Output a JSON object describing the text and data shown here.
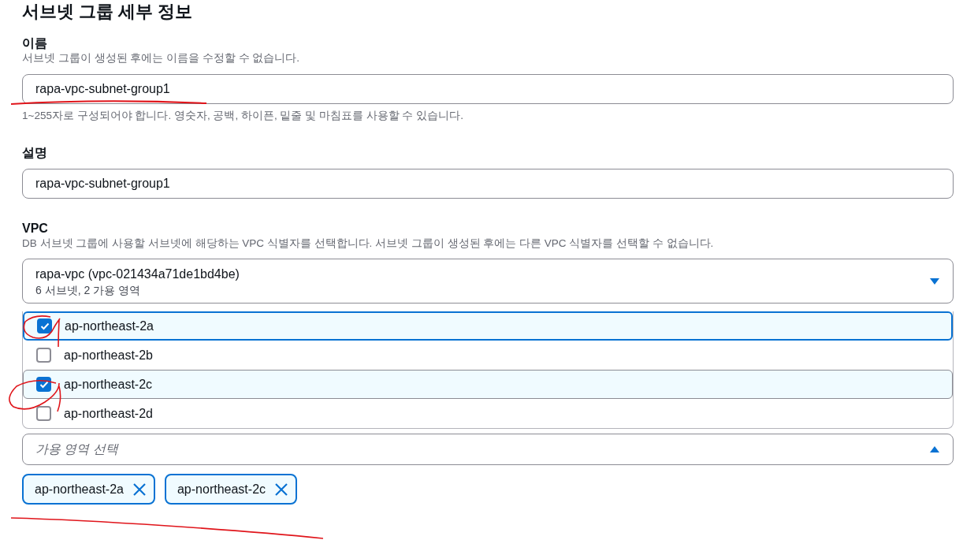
{
  "section": {
    "title": "서브넷 그룹 세부 정보"
  },
  "name_field": {
    "label": "이름",
    "description": "서브넷 그룹이 생성된 후에는 이름을 수정할 수 없습니다.",
    "value": "rapa-vpc-subnet-group1",
    "constraint": "1~255자로 구성되어야 합니다. 영숫자, 공백, 하이픈, 밑줄 및 마침표를 사용할 수 있습니다."
  },
  "description_field": {
    "label": "설명",
    "value": "rapa-vpc-subnet-group1"
  },
  "vpc_field": {
    "label": "VPC",
    "description": "DB 서브넷 그룹에 사용할 서브넷에 해당하는 VPC 식별자를 선택합니다. 서브넷 그룹이 생성된 후에는 다른 VPC 식별자를 선택할 수 없습니다.",
    "value": "rapa-vpc (vpc-021434a71de1bd4be)",
    "detail": "6 서브넷, 2 가용 영역"
  },
  "az_options": [
    {
      "label": "ap-northeast-2a",
      "checked": true,
      "highlighted": true
    },
    {
      "label": "ap-northeast-2b",
      "checked": false,
      "highlighted": false
    },
    {
      "label": "ap-northeast-2c",
      "checked": true,
      "highlighted": false
    },
    {
      "label": "ap-northeast-2d",
      "checked": false,
      "highlighted": false
    }
  ],
  "az_select": {
    "placeholder": "가용 영역 선택",
    "expanded": true
  },
  "tokens": [
    {
      "label": "ap-northeast-2a"
    },
    {
      "label": "ap-northeast-2c"
    }
  ]
}
